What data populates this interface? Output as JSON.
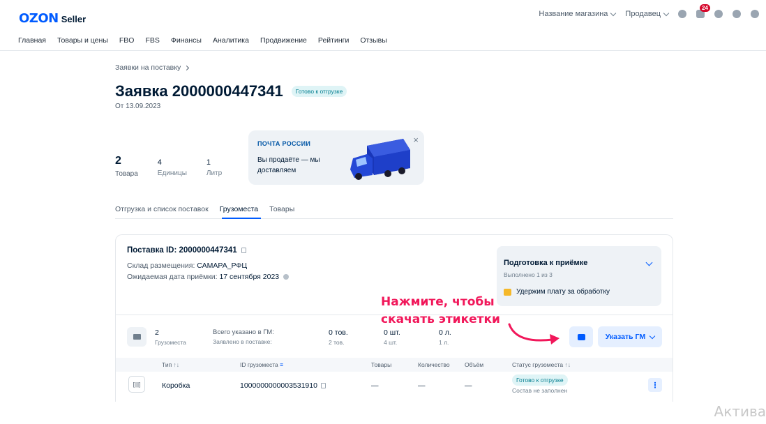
{
  "header": {
    "logo_main": "OZON",
    "logo_sub": "Seller",
    "store_dropdown": "Название магазина",
    "role_dropdown": "Продавец",
    "notifications_count": "24",
    "icons": [
      "crown-icon",
      "chat-icon",
      "help-icon",
      "education-icon",
      "megaphone-icon"
    ]
  },
  "nav": {
    "items": [
      "Главная",
      "Товары и цены",
      "FBO",
      "FBS",
      "Финансы",
      "Аналитика",
      "Продвижение",
      "Рейтинги",
      "Отзывы"
    ]
  },
  "breadcrumb": "Заявки на поставку",
  "page": {
    "title": "Заявка 2000000447341",
    "status": "Готово к отгрузке",
    "date": "От 13.09.2023"
  },
  "stats": [
    {
      "value": "2",
      "label": "Товара"
    },
    {
      "value": "4",
      "label": "Единицы"
    },
    {
      "value": "1",
      "label": "Литр"
    }
  ],
  "promo": {
    "brand": "ПОЧТА РОССИИ",
    "text": "Вы продаёте — мы доставляем",
    "close": "×"
  },
  "tabs": [
    "Отгрузка и список поставок",
    "Грузоместа",
    "Товары"
  ],
  "active_tab": "Грузоместа",
  "shipment": {
    "id_label": "Поставка ID: 2000000447341",
    "warehouse_label": "Склад размещения: ",
    "warehouse_value": "САМАРА_РФЦ",
    "date_label": "Ожидаемая дата приёмки: ",
    "date_value": "17 сентября 2023"
  },
  "prep": {
    "title": "Подготовка к приёмке",
    "progress": "Выполнено 1 из 3",
    "item": "Удержим плату за обработку"
  },
  "annotation": {
    "line1": "Нажмите, чтобы",
    "line2": "скачать этикетки"
  },
  "summary": {
    "places_value": "2",
    "places_label": "Грузоместа",
    "total_label": "Всего указано в ГМ:",
    "declared_label": "Заявлено в поставке:",
    "goods_value": "0 тов.",
    "goods_declared": "2 тов.",
    "pcs_value": "0 шт.",
    "pcs_declared": "4 шт.",
    "vol_value": "0 л.",
    "vol_declared": "1 л."
  },
  "buttons": {
    "specify_gm": "Указать ГМ"
  },
  "table": {
    "headers": {
      "type": "Тип",
      "id": "ID грузоместа",
      "goods": "Товары",
      "qty": "Количество",
      "volume": "Объём",
      "status": "Статус грузоместа"
    },
    "rows": [
      {
        "type": "Коробка",
        "id": "1000000000003531910",
        "goods": "—",
        "qty": "—",
        "volume": "—",
        "status": "Готово к отгрузке",
        "status_sub": "Состав не заполнен"
      }
    ]
  },
  "watermark": "Актива",
  "colors": {
    "accent": "#005bff",
    "annotation": "#f1175a",
    "status_bg": "#dff4f6",
    "status_fg": "#007d8f"
  }
}
